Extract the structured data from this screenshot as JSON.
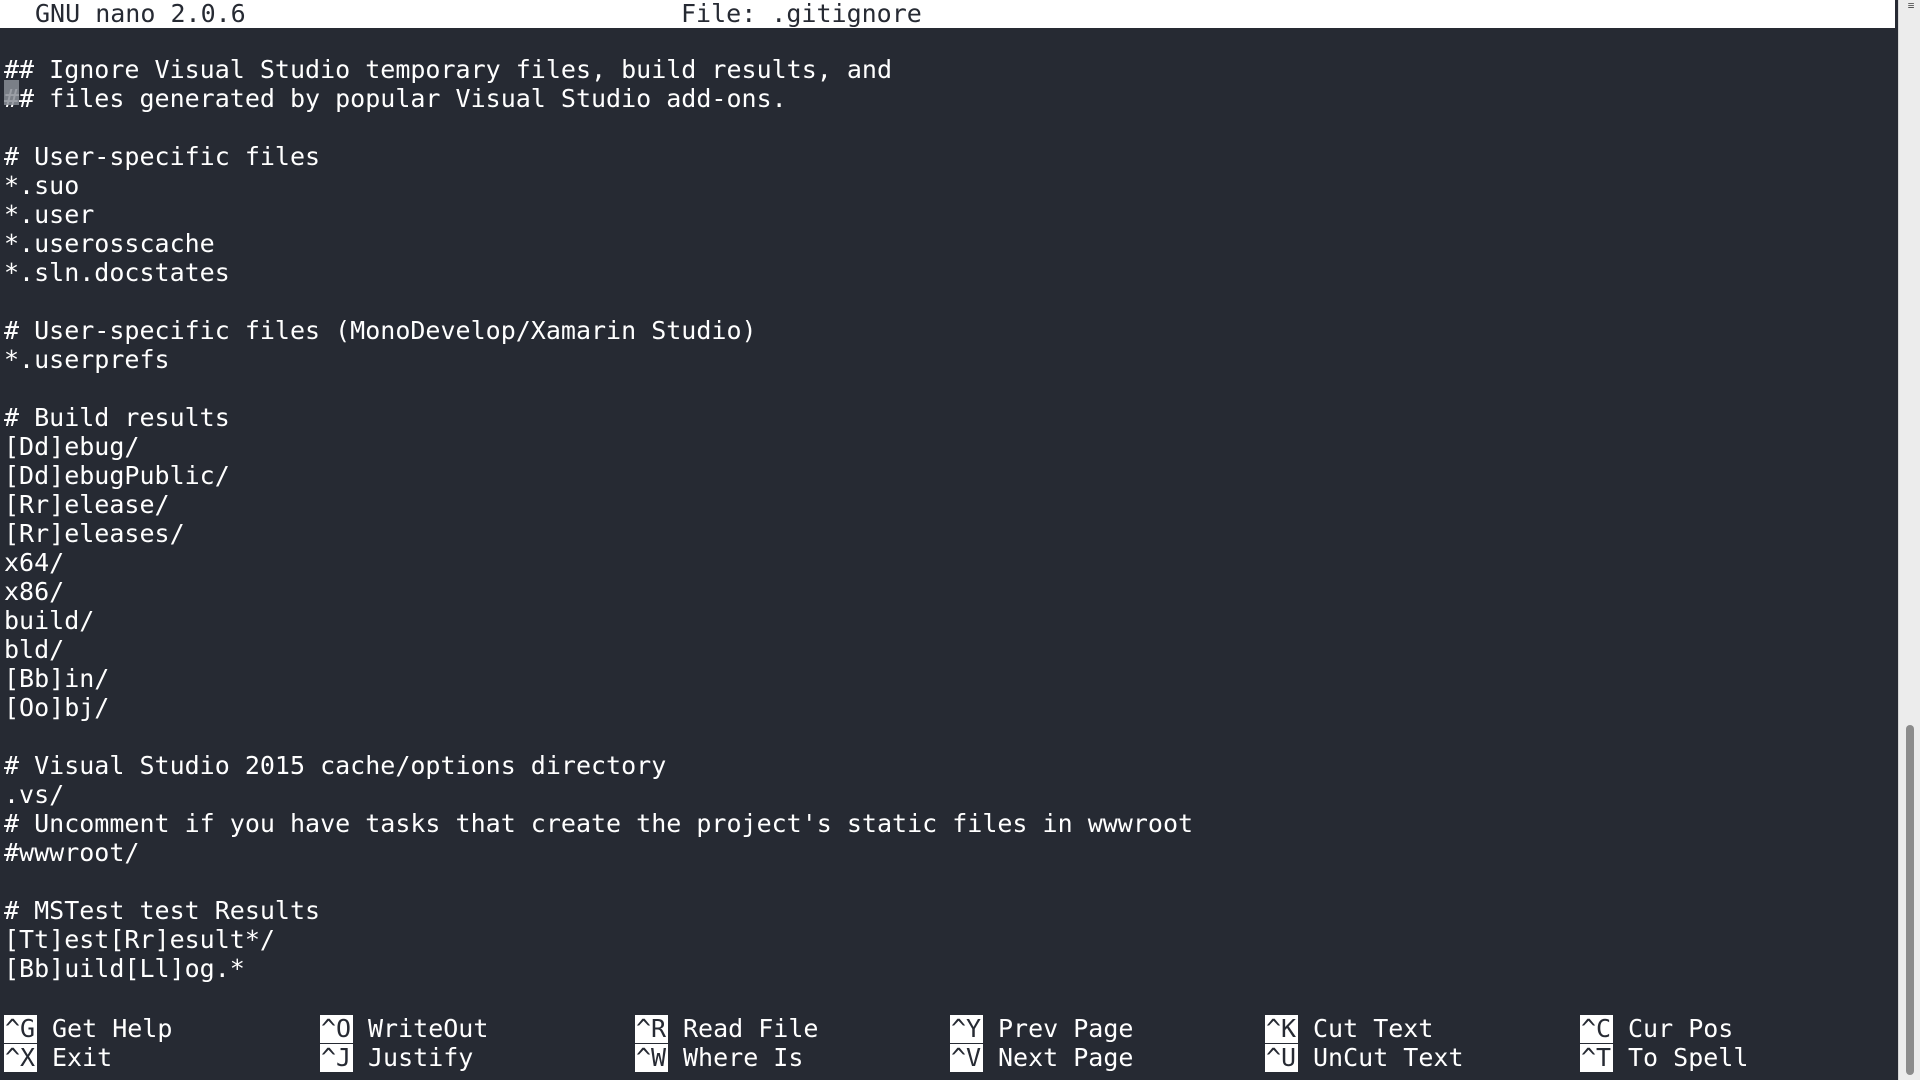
{
  "titlebar": {
    "version": "GNU nano 2.0.6",
    "file": "File: .gitignore"
  },
  "editor": {
    "lines": [
      "## Ignore Visual Studio temporary files, build results, and",
      "## files generated by popular Visual Studio add-ons.",
      "",
      "# User-specific files",
      "*.suo",
      "*.user",
      "*.userosscache",
      "*.sln.docstates",
      "",
      "# User-specific files (MonoDevelop/Xamarin Studio)",
      "*.userprefs",
      "",
      "# Build results",
      "[Dd]ebug/",
      "[Dd]ebugPublic/",
      "[Rr]elease/",
      "[Rr]eleases/",
      "x64/",
      "x86/",
      "build/",
      "bld/",
      "[Bb]in/",
      "[Oo]bj/",
      "",
      "# Visual Studio 2015 cache/options directory",
      ".vs/",
      "# Uncomment if you have tasks that create the project's static files in wwwroot",
      "#wwwroot/",
      "",
      "# MSTest test Results",
      "[Tt]est[Rr]esult*/",
      "[Bb]uild[Ll]og.*"
    ]
  },
  "shortcuts": [
    {
      "key": "^G",
      "label": "Get Help"
    },
    {
      "key": "^X",
      "label": "Exit"
    },
    {
      "key": "^O",
      "label": "WriteOut"
    },
    {
      "key": "^J",
      "label": "Justify"
    },
    {
      "key": "^R",
      "label": "Read File"
    },
    {
      "key": "^W",
      "label": "Where Is"
    },
    {
      "key": "^Y",
      "label": "Prev Page"
    },
    {
      "key": "^V",
      "label": "Next Page"
    },
    {
      "key": "^K",
      "label": "Cut Text"
    },
    {
      "key": "^U",
      "label": "UnCut Text"
    },
    {
      "key": "^C",
      "label": "Cur Pos"
    },
    {
      "key": "^T",
      "label": "To Spell"
    }
  ],
  "colors": {
    "background": "#262a33",
    "foreground": "#ffffff",
    "inverse_bg": "#ffffff",
    "inverse_fg": "#262a33"
  }
}
